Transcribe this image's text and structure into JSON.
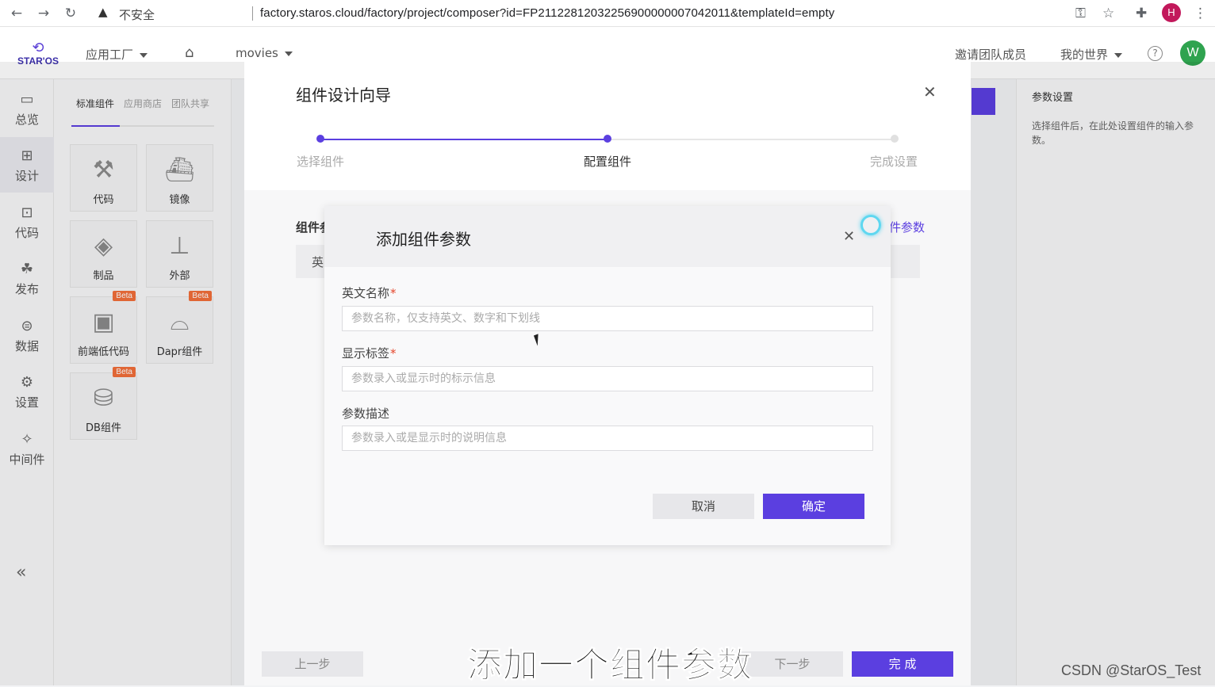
{
  "browser": {
    "insecure_label": "不安全",
    "url": "factory.staros.cloud/factory/project/composer?id=FP21122812032256900000007042011&templateId=empty",
    "profile_initial": "H"
  },
  "header": {
    "logo_text": "STAR'OS",
    "app_factory": "应用工厂",
    "project": "movies",
    "invite": "邀请团队成员",
    "my_world": "我的世界",
    "help": "?",
    "avatar_initial": "W"
  },
  "rail": {
    "items": [
      {
        "label": "总览",
        "icon": "monitor-icon"
      },
      {
        "label": "设计",
        "icon": "design-icon"
      },
      {
        "label": "代码",
        "icon": "code-icon"
      },
      {
        "label": "发布",
        "icon": "publish-icon"
      },
      {
        "label": "数据",
        "icon": "data-icon"
      },
      {
        "label": "设置",
        "icon": "gear-icon"
      },
      {
        "label": "中间件",
        "icon": "middleware-icon"
      }
    ]
  },
  "panel": {
    "tabs": [
      "标准组件",
      "应用商店",
      "团队共享"
    ],
    "cards": [
      {
        "label": "代码",
        "icon": "robot-arm-icon",
        "beta": ""
      },
      {
        "label": "镜像",
        "icon": "docker-icon",
        "beta": ""
      },
      {
        "label": "制品",
        "icon": "package-icon",
        "beta": ""
      },
      {
        "label": "外部",
        "icon": "network-icon",
        "beta": ""
      },
      {
        "label": "前端低代码",
        "icon": "lowcode-icon",
        "beta": "Beta"
      },
      {
        "label": "Dapr组件",
        "icon": "dapr-icon",
        "beta": "Beta"
      },
      {
        "label": "DB组件",
        "icon": "database-icon",
        "beta": "Beta"
      }
    ]
  },
  "right_panel": {
    "title": "参数设置",
    "description": "选择组件后，在此处设置组件的输入参数。"
  },
  "wizard": {
    "title": "组件设计向导",
    "steps": [
      "选择组件",
      "配置组件",
      "完成设置"
    ],
    "current_step": 2,
    "section_label": "组件参",
    "add_link": "件参数",
    "table_head": "英",
    "prev": "上一步",
    "next": "下一步",
    "finish": "完 成"
  },
  "modal": {
    "title": "添加组件参数",
    "fields": [
      {
        "label": "英文名称",
        "required": "*",
        "placeholder": "参数名称，仅支持英文、数字和下划线"
      },
      {
        "label": "显示标签",
        "required": "*",
        "placeholder": "参数录入或显示时的标示信息"
      },
      {
        "label": "参数描述",
        "required": "",
        "placeholder": "参数录入或是显示时的说明信息"
      }
    ],
    "cancel": "取消",
    "ok": "确定"
  },
  "colors": {
    "accent": "#5b3fe0",
    "required": "#e5462b",
    "beta": "#f16e3a",
    "avatar": "#2fa34f"
  },
  "subtitle": "添加一个组件参数",
  "watermark": "CSDN @StarOS_Test"
}
